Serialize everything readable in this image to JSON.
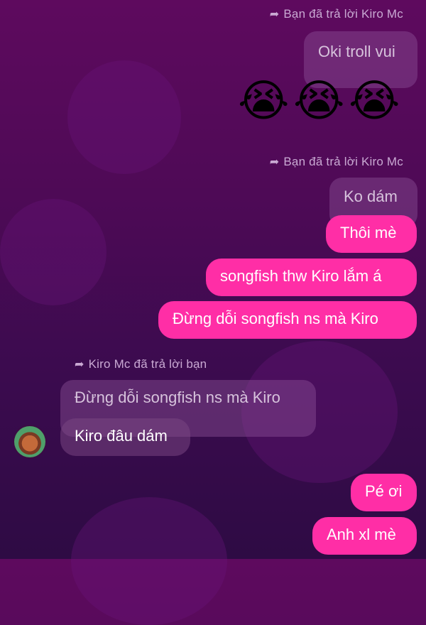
{
  "notes": {
    "n1": "Bạn đã trả lời Kiro Mc",
    "n2": "Bạn đã trả lời Kiro Mc",
    "n3": "Kiro Mc đã trả lời bạn"
  },
  "messages": {
    "q1": "Oki troll vui",
    "emoji": [
      "😭",
      "😭",
      "😭"
    ],
    "q2": "Ko dám",
    "m1": "Thôi mè",
    "m2": "songfish thw Kiro lắm á",
    "m3": "Đừng dỗi songfish ns mà Kiro",
    "q3": "Đừng dỗi songfish ns mà Kiro",
    "r1": "Kiro đâu dám",
    "m4": "Pé ơi",
    "m5": "Anh xl mè"
  },
  "colors": {
    "sent_bubble": "#ff2ea6",
    "received_bubble": "#7a4a86",
    "quoted_bubble": "#8c5096",
    "background": "#4e0a56"
  },
  "icons": {
    "reply": "reply-arrow-icon",
    "avatar": "contact-avatar"
  }
}
